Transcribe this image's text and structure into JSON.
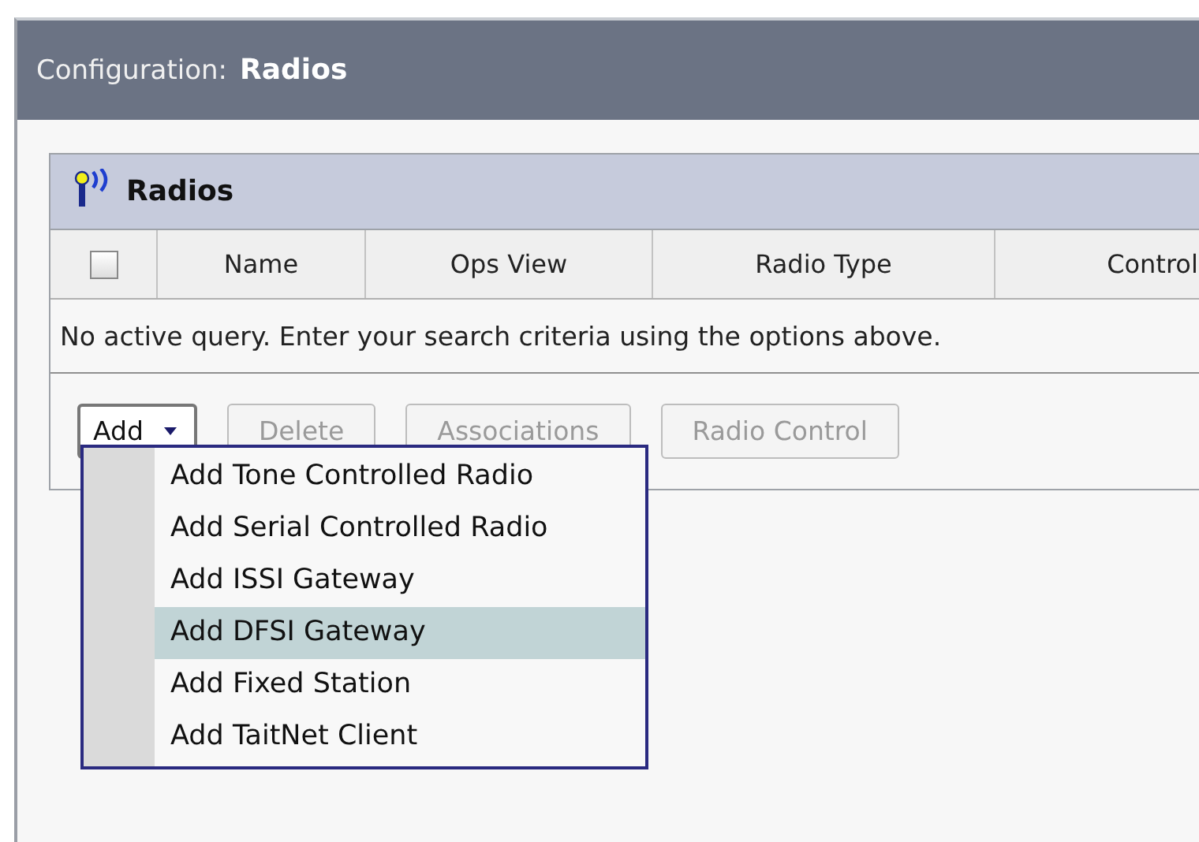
{
  "header": {
    "label": "Configuration:",
    "title": "Radios"
  },
  "panel": {
    "title": "Radios",
    "select_all": {
      "checked": false
    },
    "columns": [
      "Name",
      "Ops View",
      "Radio Type",
      "Control"
    ],
    "message": "No active query. Enter your search criteria using the options above."
  },
  "toolbar": {
    "buttons": [
      {
        "kind": "dropdown",
        "label": "Add",
        "disabled": false
      },
      {
        "kind": "button",
        "label": "Delete",
        "disabled": true
      },
      {
        "kind": "button",
        "label": "Associations",
        "disabled": true
      },
      {
        "kind": "button",
        "label": "Radio Control",
        "disabled": true
      }
    ]
  },
  "menu": {
    "items": [
      {
        "label": "Add Tone Controlled Radio",
        "selected": false
      },
      {
        "label": "Add Serial Controlled Radio",
        "selected": false
      },
      {
        "label": "Add ISSI Gateway",
        "selected": false
      },
      {
        "label": "Add DFSI Gateway",
        "selected": true
      },
      {
        "label": "Add Fixed Station",
        "selected": false
      },
      {
        "label": "Add TaitNet Client",
        "selected": false
      }
    ]
  }
}
